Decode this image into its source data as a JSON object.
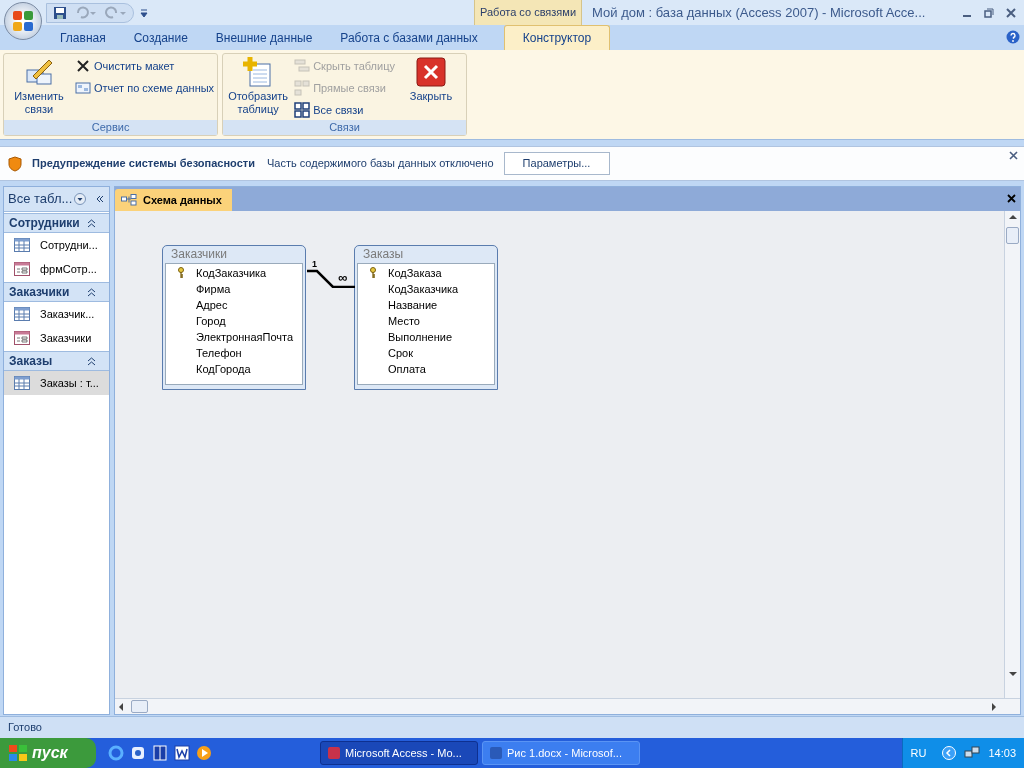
{
  "window": {
    "title": "Мой дом : база данных (Access 2007)  -  Microsoft Acce...",
    "contextual_tab": "Работа со связями"
  },
  "ribbon": {
    "tabs": [
      {
        "label": "Главная",
        "selected": false
      },
      {
        "label": "Создание",
        "selected": false
      },
      {
        "label": "Внешние данные",
        "selected": false
      },
      {
        "label": "Работа с базами данных",
        "selected": false
      },
      {
        "label": "Конструктор",
        "selected": true
      }
    ],
    "groups": [
      {
        "label": "Сервис",
        "items": [
          {
            "kind": "large",
            "label": "Изменить связи",
            "disabled": false
          },
          {
            "kind": "small",
            "label": "Очистить макет",
            "disabled": false
          },
          {
            "kind": "small",
            "label": "Отчет по схеме данных",
            "disabled": false
          }
        ]
      },
      {
        "label": "Связи",
        "items": [
          {
            "kind": "large",
            "label": "Отобразить таблицу",
            "disabled": false
          },
          {
            "kind": "small",
            "label": "Скрыть таблицу",
            "disabled": true
          },
          {
            "kind": "small",
            "label": "Прямые связи",
            "disabled": true
          },
          {
            "kind": "small",
            "label": "Все связи",
            "disabled": false
          },
          {
            "kind": "large",
            "label": "Закрыть",
            "disabled": false
          }
        ]
      }
    ]
  },
  "security_bar": {
    "title": "Предупреждение системы безопасности",
    "message": "Часть содержимого базы данных отключено",
    "button": "Параметры..."
  },
  "nav_pane": {
    "header": "Все табл...",
    "groups": [
      {
        "label": "Сотрудники",
        "items": [
          {
            "kind": "table",
            "label": "Сотрудни...",
            "selected": false
          },
          {
            "kind": "form",
            "label": "фрмСотр...",
            "selected": false
          }
        ]
      },
      {
        "label": "Заказчики",
        "items": [
          {
            "kind": "table",
            "label": "Заказчик...",
            "selected": false
          },
          {
            "kind": "form",
            "label": "Заказчики",
            "selected": false
          }
        ]
      },
      {
        "label": "Заказы",
        "items": [
          {
            "kind": "table",
            "label": "Заказы : т...",
            "selected": true
          }
        ]
      }
    ]
  },
  "document_tab": {
    "label": "Схема данных"
  },
  "diagram": {
    "tables": [
      {
        "title": "Заказчики",
        "fields": [
          {
            "name": "КодЗаказчика",
            "key": true
          },
          {
            "name": "Фирма",
            "key": false
          },
          {
            "name": "Адрес",
            "key": false
          },
          {
            "name": "Город",
            "key": false
          },
          {
            "name": "ЭлектроннаяПочта",
            "key": false
          },
          {
            "name": "Телефон",
            "key": false
          },
          {
            "name": "КодГорода",
            "key": false
          }
        ]
      },
      {
        "title": "Заказы",
        "fields": [
          {
            "name": "КодЗаказа",
            "key": true
          },
          {
            "name": "КодЗаказчика",
            "key": false
          },
          {
            "name": "Название",
            "key": false
          },
          {
            "name": "Место",
            "key": false
          },
          {
            "name": "Выполнение",
            "key": false
          },
          {
            "name": "Срок",
            "key": false
          },
          {
            "name": "Оплата",
            "key": false
          }
        ]
      }
    ],
    "relationship": {
      "one_label": "1",
      "many_label": "∞"
    }
  },
  "status_bar": {
    "text": "Готово"
  },
  "taskbar": {
    "start": "пуск",
    "windows": [
      {
        "label": "Microsoft Access - Mo...",
        "selected": true
      },
      {
        "label": "Рис 1.docx - Microsof...",
        "selected": false
      }
    ],
    "language": "RU",
    "clock": "14:03"
  }
}
